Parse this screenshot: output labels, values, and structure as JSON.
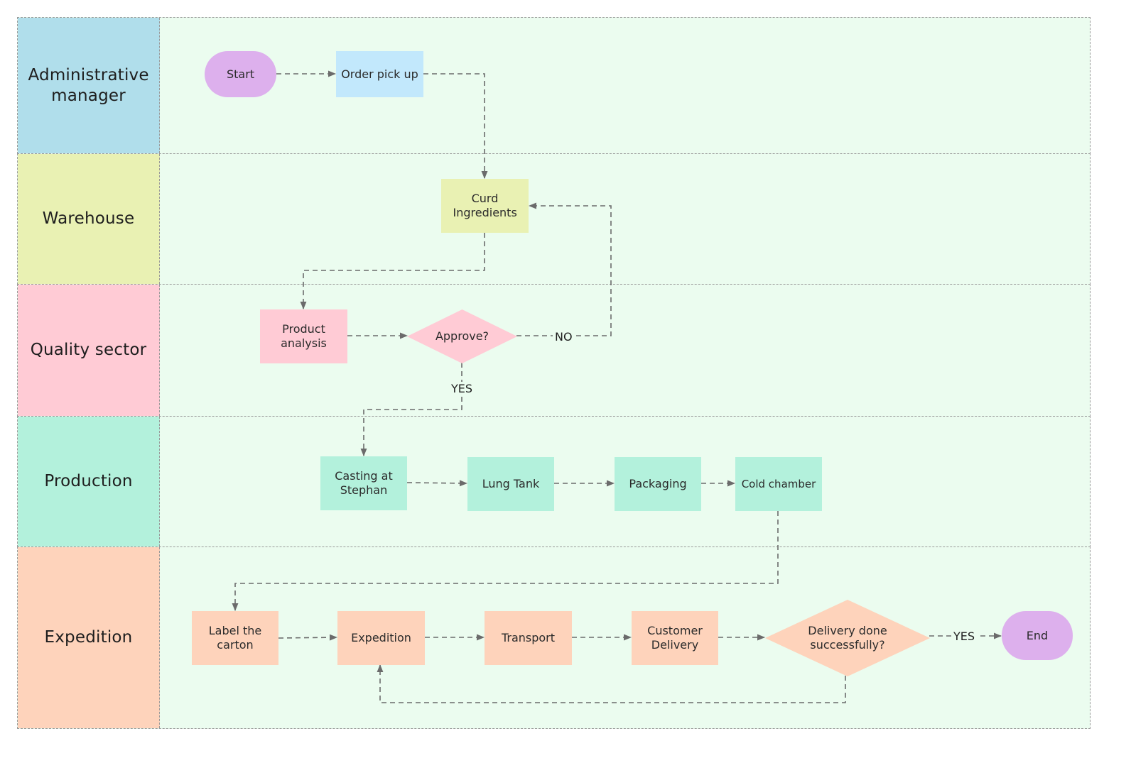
{
  "colors": {
    "lane_body": "#ebfcef",
    "connector": "#6b6b6b",
    "admin": "#b0deeb",
    "warehouse": "#e9f1b3",
    "quality": "#ffcbd5",
    "production": "#b3f1dc",
    "expedition": "#fed3bb",
    "terminal": "#ddb0ed",
    "order_box": "#c2e8fc"
  },
  "lanes": [
    {
      "id": "admin",
      "label": "Administrative manager",
      "color": "#b0deeb"
    },
    {
      "id": "warehouse",
      "label": "Warehouse",
      "color": "#e9f1b3"
    },
    {
      "id": "quality",
      "label": "Quality sector",
      "color": "#ffcbd5"
    },
    {
      "id": "production",
      "label": "Production",
      "color": "#b3f1dc"
    },
    {
      "id": "expedition",
      "label": "Expedition",
      "color": "#fed3bb"
    }
  ],
  "nodes": {
    "start": {
      "label": "Start",
      "shape": "terminal",
      "lane": "admin"
    },
    "order_pick_up": {
      "label": "Order pick up",
      "shape": "process",
      "lane": "admin"
    },
    "curd_ingredients": {
      "label": "Curd Ingredients",
      "shape": "process",
      "lane": "warehouse"
    },
    "product_analysis": {
      "label": "Product analysis",
      "shape": "process",
      "lane": "quality"
    },
    "approve": {
      "label": "Approve?",
      "shape": "decision",
      "lane": "quality"
    },
    "casting": {
      "label": "Casting at Stephan",
      "shape": "process",
      "lane": "production"
    },
    "lung_tank": {
      "label": "Lung Tank",
      "shape": "process",
      "lane": "production"
    },
    "packaging": {
      "label": "Packaging",
      "shape": "process",
      "lane": "production"
    },
    "cold_chamber": {
      "label": "Cold chamber",
      "shape": "process",
      "lane": "production"
    },
    "label_carton": {
      "label": "Label the carton",
      "shape": "process",
      "lane": "expedition"
    },
    "expedition": {
      "label": "Expedition",
      "shape": "process",
      "lane": "expedition"
    },
    "transport": {
      "label": "Transport",
      "shape": "process",
      "lane": "expedition"
    },
    "customer_delivery": {
      "label": "Customer Delivery",
      "shape": "process",
      "lane": "expedition"
    },
    "delivery_done": {
      "label": "Delivery done successfully?",
      "shape": "decision",
      "lane": "expedition"
    },
    "end": {
      "label": "End",
      "shape": "terminal",
      "lane": "expedition"
    }
  },
  "edges": [
    {
      "from": "start",
      "to": "order_pick_up",
      "label": ""
    },
    {
      "from": "order_pick_up",
      "to": "curd_ingredients",
      "label": ""
    },
    {
      "from": "curd_ingredients",
      "to": "product_analysis",
      "label": ""
    },
    {
      "from": "product_analysis",
      "to": "approve",
      "label": ""
    },
    {
      "from": "approve",
      "to": "curd_ingredients",
      "label": "NO"
    },
    {
      "from": "approve",
      "to": "casting",
      "label": "YES"
    },
    {
      "from": "casting",
      "to": "lung_tank",
      "label": ""
    },
    {
      "from": "lung_tank",
      "to": "packaging",
      "label": ""
    },
    {
      "from": "packaging",
      "to": "cold_chamber",
      "label": ""
    },
    {
      "from": "cold_chamber",
      "to": "label_carton",
      "label": ""
    },
    {
      "from": "label_carton",
      "to": "expedition",
      "label": ""
    },
    {
      "from": "expedition",
      "to": "transport",
      "label": ""
    },
    {
      "from": "transport",
      "to": "customer_delivery",
      "label": ""
    },
    {
      "from": "customer_delivery",
      "to": "delivery_done",
      "label": ""
    },
    {
      "from": "delivery_done",
      "to": "end",
      "label": "YES"
    },
    {
      "from": "delivery_done",
      "to": "expedition",
      "label": ""
    }
  ],
  "edge_labels": {
    "approve_no": "NO",
    "approve_yes": "YES",
    "delivery_yes": "YES"
  }
}
